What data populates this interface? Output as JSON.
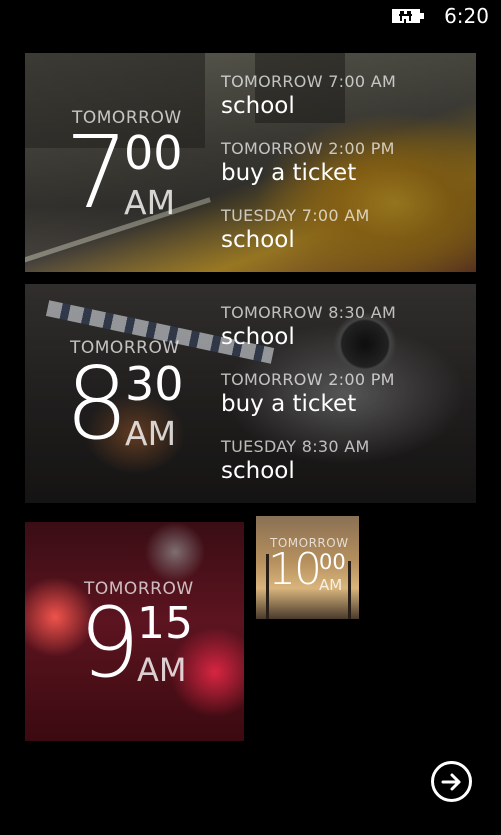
{
  "status_bar": {
    "time": "6:20",
    "battery_icon": "battery-charging-icon"
  },
  "alarms": [
    {
      "label": "TOMORROW",
      "hour": "7",
      "minute": "00",
      "ampm": "AM",
      "events": [
        {
          "time": "TOMORROW 7:00 AM",
          "title": "school"
        },
        {
          "time": "TOMORROW 2:00 PM",
          "title": "buy a ticket"
        },
        {
          "time": "TUESDAY 7:00 AM",
          "title": "school"
        }
      ]
    },
    {
      "label": "TOMORROW",
      "hour": "8",
      "minute": "30",
      "ampm": "AM",
      "events": [
        {
          "time": "TOMORROW 8:30 AM",
          "title": "school"
        },
        {
          "time": "TOMORROW 2:00 PM",
          "title": "buy a ticket"
        },
        {
          "time": "TUESDAY 8:30 AM",
          "title": "school"
        }
      ]
    },
    {
      "label": "TOMORROW",
      "hour": "9",
      "minute": "15",
      "ampm": "AM"
    },
    {
      "label": "TOMORROW",
      "hour": "10",
      "minute": "00",
      "ampm": "AM"
    }
  ],
  "next_button_icon": "arrow-right-circle-icon",
  "colors": {
    "background": "#000000",
    "text": "#ffffff"
  }
}
